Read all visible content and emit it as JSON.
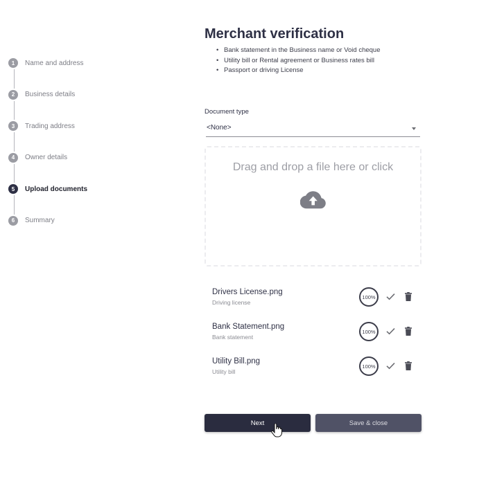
{
  "stepper": {
    "steps": [
      {
        "number": "1",
        "label": "Name and address"
      },
      {
        "number": "2",
        "label": "Business details"
      },
      {
        "number": "3",
        "label": "Trading address"
      },
      {
        "number": "4",
        "label": "Owner details"
      },
      {
        "number": "5",
        "label": "Upload documents",
        "active": true
      },
      {
        "number": "6",
        "label": "Summary"
      }
    ]
  },
  "main": {
    "title": "Merchant verification",
    "requirements": [
      "Bank statement in the Business name or Void cheque",
      "Utility bill or Rental agreement or Business rates bill",
      "Passport or driving License"
    ],
    "document_type": {
      "label": "Document type",
      "value": "<None>"
    },
    "dropzone": {
      "text": "Drag and drop a file here or click",
      "icon": "cloud-upload-icon"
    }
  },
  "files": [
    {
      "name": "Drivers License.png",
      "type": "Driving license",
      "progress": "100%"
    },
    {
      "name": "Bank Statement.png",
      "type": "Bank statement",
      "progress": "100%"
    },
    {
      "name": "Utility Bill.png",
      "type": "Utility bill",
      "progress": "100%"
    }
  ],
  "actions": {
    "next_label": "Next",
    "save_label": "Save & close"
  },
  "colors": {
    "primary": "#2a2c3f",
    "secondary_button": "#505266",
    "step_inactive": "#9b9ca3",
    "text": "#2e3045"
  }
}
